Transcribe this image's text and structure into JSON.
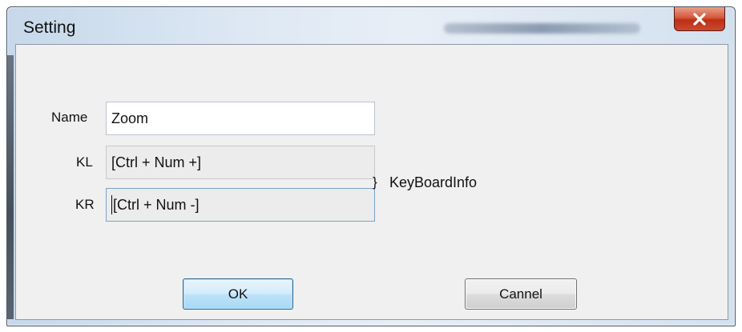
{
  "window": {
    "title": "Setting",
    "close_icon": "close-x-icon"
  },
  "form": {
    "name_label": "Name",
    "name_value": "Zoom",
    "kl_label": "KL",
    "kl_value": "[Ctrl + Num +]",
    "kr_label": "KR",
    "kr_value": "[Ctrl + Num -]",
    "brace": "}",
    "keyboard_info_label": "KeyBoardInfo"
  },
  "buttons": {
    "ok_label": "OK",
    "cancel_label": "Cannel"
  },
  "colors": {
    "close_button": "#c9452b",
    "ok_button_border": "#2c628b",
    "client_background": "#f0f0f0"
  }
}
